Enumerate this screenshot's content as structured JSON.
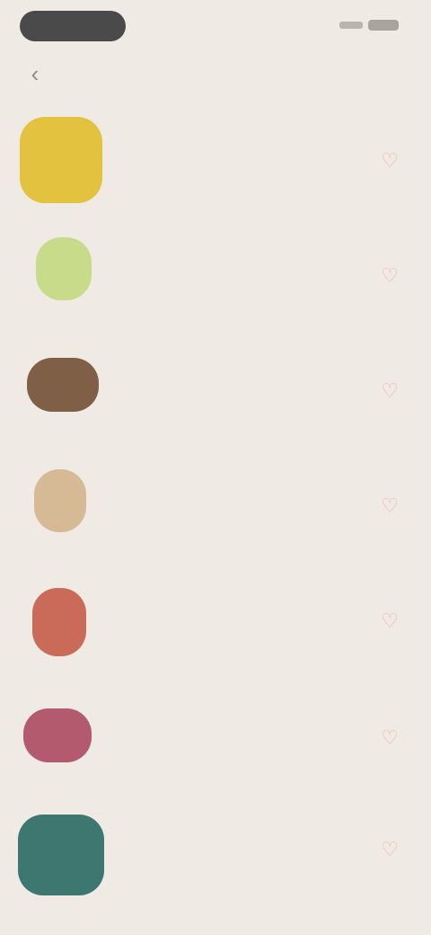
{
  "status_bar": {
    "time": "",
    "battery": ""
  },
  "header": {
    "title": "",
    "back_icon": "chevron-left-icon"
  },
  "items": [
    {
      "title": "",
      "subtitle": "",
      "color": "#e3c23f"
    },
    {
      "title": "",
      "subtitle": "",
      "color": "#c7db8b"
    },
    {
      "title": "",
      "subtitle": "",
      "color": "#7f6046"
    },
    {
      "title": "",
      "subtitle": "",
      "color": "#d6b995"
    },
    {
      "title": "",
      "subtitle": "",
      "color": "#c96b58"
    },
    {
      "title": "",
      "subtitle": "",
      "color": "#b35a6f"
    },
    {
      "title": "",
      "subtitle": "",
      "color": "#3d7770"
    }
  ],
  "icons": {
    "favorite": "heart-icon"
  },
  "colors": {
    "background": "#efebe4",
    "accent": "#f0b7a3"
  }
}
